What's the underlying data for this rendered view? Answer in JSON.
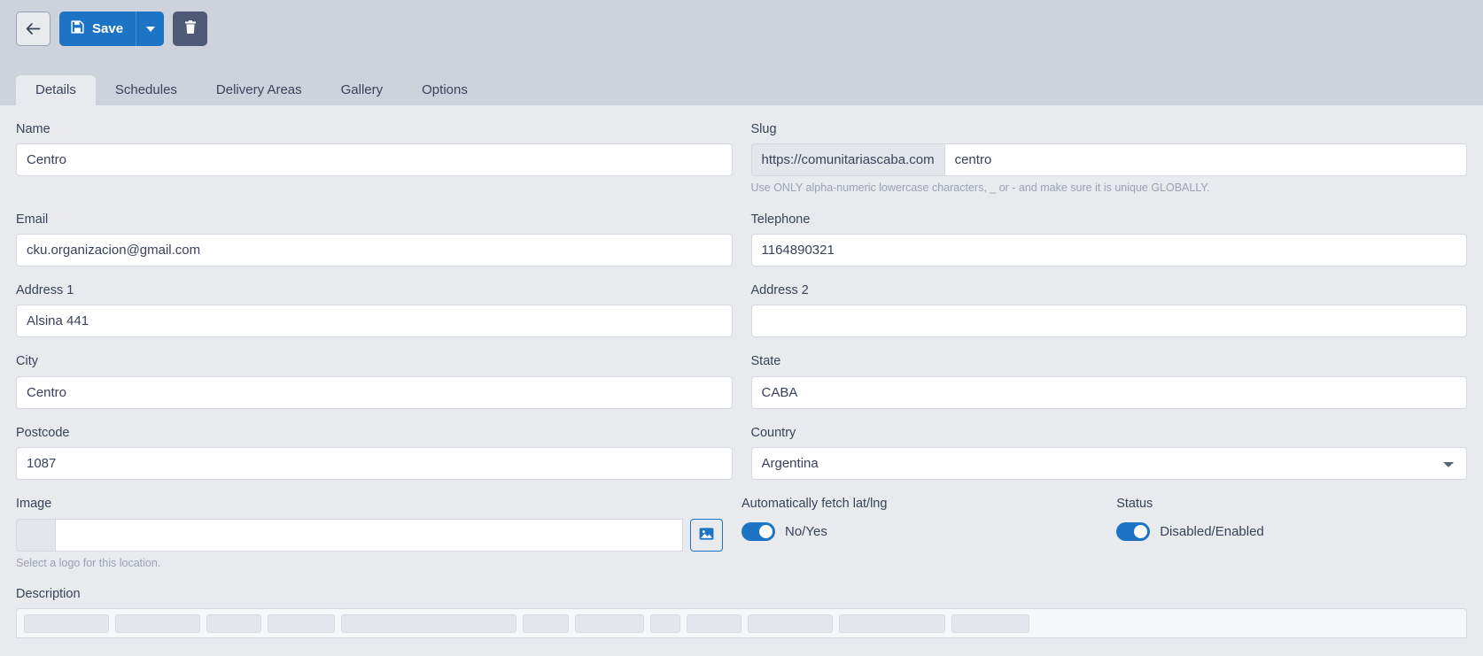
{
  "toolbar": {
    "back_label": "",
    "back_icon": "arrow-left-icon",
    "save_label": "Save",
    "save_icon": "floppy-disk-save-icon",
    "save_dropdown_icon": "chevron-down-icon",
    "delete_icon": "trash-can-icon",
    "accent_color": "#1d74c4",
    "delete_color": "#4e5a75"
  },
  "tabs": [
    {
      "label": "Details",
      "active": true
    },
    {
      "label": "Schedules",
      "active": false
    },
    {
      "label": "Delivery Areas",
      "active": false
    },
    {
      "label": "Gallery",
      "active": false
    },
    {
      "label": "Options",
      "active": false
    }
  ],
  "fields": {
    "name": {
      "label": "Name",
      "value": "Centro",
      "placeholder": ""
    },
    "slug": {
      "label": "Slug",
      "prefix": "https://comunitariascaba.com",
      "value": "centro",
      "placeholder": "",
      "help": "Use ONLY alpha-numeric lowercase characters, _ or - and make sure it is unique GLOBALLY."
    },
    "email": {
      "label": "Email",
      "value": "cku.organizacion@gmail.com",
      "placeholder": ""
    },
    "telephone": {
      "label": "Telephone",
      "value": "1164890321",
      "placeholder": ""
    },
    "address1": {
      "label": "Address 1",
      "value": "Alsina 441",
      "placeholder": ""
    },
    "address2": {
      "label": "Address 2",
      "value": "",
      "placeholder": ""
    },
    "city": {
      "label": "City",
      "value": "Centro",
      "placeholder": ""
    },
    "state": {
      "label": "State",
      "value": "CABA",
      "placeholder": ""
    },
    "postcode": {
      "label": "Postcode",
      "value": "1087",
      "placeholder": ""
    },
    "country": {
      "label": "Country",
      "value": "Argentina",
      "options": [
        "Argentina"
      ]
    },
    "image": {
      "label": "Image",
      "value": "",
      "placeholder": "",
      "help": "Select a logo for this location.",
      "button_icon": "image-picture-icon"
    },
    "autofetch": {
      "label": "Automatically fetch lat/lng",
      "toggle_label": "No/Yes",
      "enabled": true
    },
    "status": {
      "label": "Status",
      "toggle_label": "Disabled/Enabled",
      "enabled": true
    },
    "description": {
      "label": "Description"
    }
  }
}
